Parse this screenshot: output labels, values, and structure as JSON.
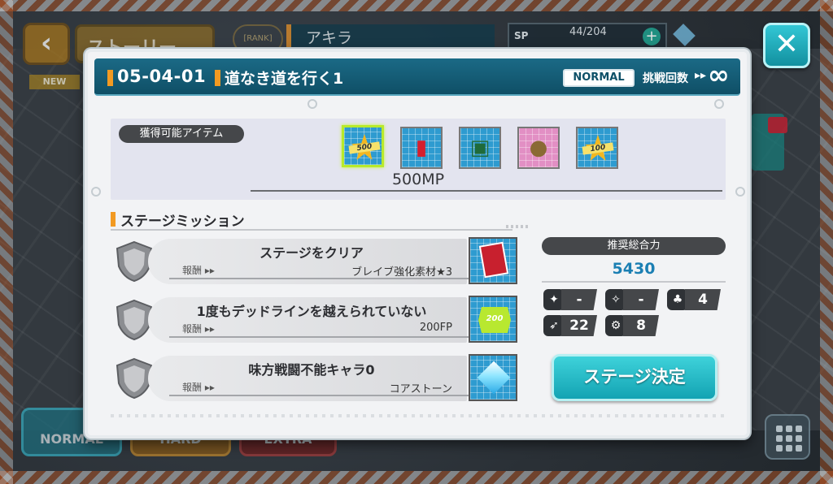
{
  "background": {
    "back_icon": "chevron-left-icon",
    "story_label": "ストーリー",
    "rank_label": "[RANK]",
    "player_name": "アキラ",
    "sp": {
      "label": "SP",
      "value": "44/204"
    },
    "new_label": "NEW",
    "tabs": [
      "NORMAL",
      "HARD",
      "EXTRA"
    ]
  },
  "close_icon": "✕",
  "dialog": {
    "stage_code": "05-04-01",
    "stage_title": "道なき道を行く1",
    "difficulty": "NORMAL",
    "challenge_label": "挑戦回数",
    "challenge_arrows": "▸▸",
    "challenge_count": "∞",
    "items": {
      "label": "獲得可能アイテム",
      "list": [
        {
          "name": "star-ticket-500",
          "badge": "500"
        },
        {
          "name": "red-card-book"
        },
        {
          "name": "green-chip"
        },
        {
          "name": "money-bag"
        },
        {
          "name": "star-ticket-100",
          "badge": "100"
        }
      ],
      "selected_value": "500MP"
    },
    "missions": {
      "heading": "ステージミッション",
      "reward_label": "報酬 ▸▸",
      "list": [
        {
          "title": "ステージをクリア",
          "reward": "ブレイブ強化素材★3",
          "icon": "red-book-icon"
        },
        {
          "title": "1度もデッドラインを越えられていない",
          "reward": "200FP",
          "icon": "fp-token-icon",
          "icon_text": "200"
        },
        {
          "title": "味方戦闘不能キャラ0",
          "reward": "コアストーン",
          "icon": "core-stone-icon"
        }
      ]
    },
    "recommended": {
      "label": "推奨総合力",
      "value": "5430",
      "stats": [
        {
          "icon": "dragon-icon",
          "value": "-"
        },
        {
          "icon": "beast-icon",
          "value": "-"
        },
        {
          "icon": "tree-icon",
          "value": "4"
        },
        {
          "icon": "bird-icon",
          "value": "22"
        },
        {
          "icon": "gear-icon",
          "value": "8"
        }
      ]
    },
    "decide_button": "ステージ決定"
  }
}
